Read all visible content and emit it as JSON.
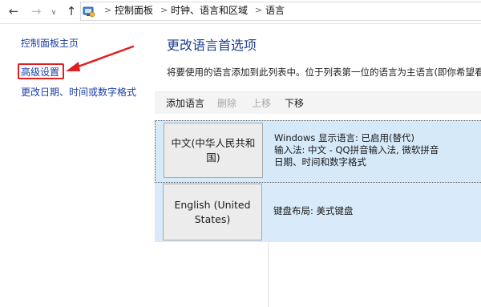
{
  "address_bar": {
    "breadcrumbs": [
      "控制面板",
      "时钟、语言和区域",
      "语言"
    ],
    "separator": ">"
  },
  "left_pane": {
    "links": [
      {
        "label": "控制面板主页"
      },
      {
        "label": "高级设置"
      },
      {
        "label": "更改日期、时间或数字格式"
      }
    ],
    "annotation_color": "#e02020"
  },
  "main": {
    "title": "更改语言首选项",
    "description": "将要使用的语言添加到此列表中。位于列表第一位的语言为主语言(即你希望看到",
    "toolbar": {
      "add": "添加语言",
      "remove": "删除",
      "move_up": "上移",
      "move_down": "下移"
    },
    "languages": [
      {
        "name": "中文(中华人民共和国)",
        "details": [
          "Windows 显示语言: 已启用(替代)",
          "输入法: 中文 - QQ拼音输入法, 微软拼音",
          "日期、时间和数字格式"
        ]
      },
      {
        "name": "English (United States)",
        "details": [
          "键盘布局: 美式键盘"
        ]
      }
    ],
    "selection_color": "#d6e9f9"
  }
}
